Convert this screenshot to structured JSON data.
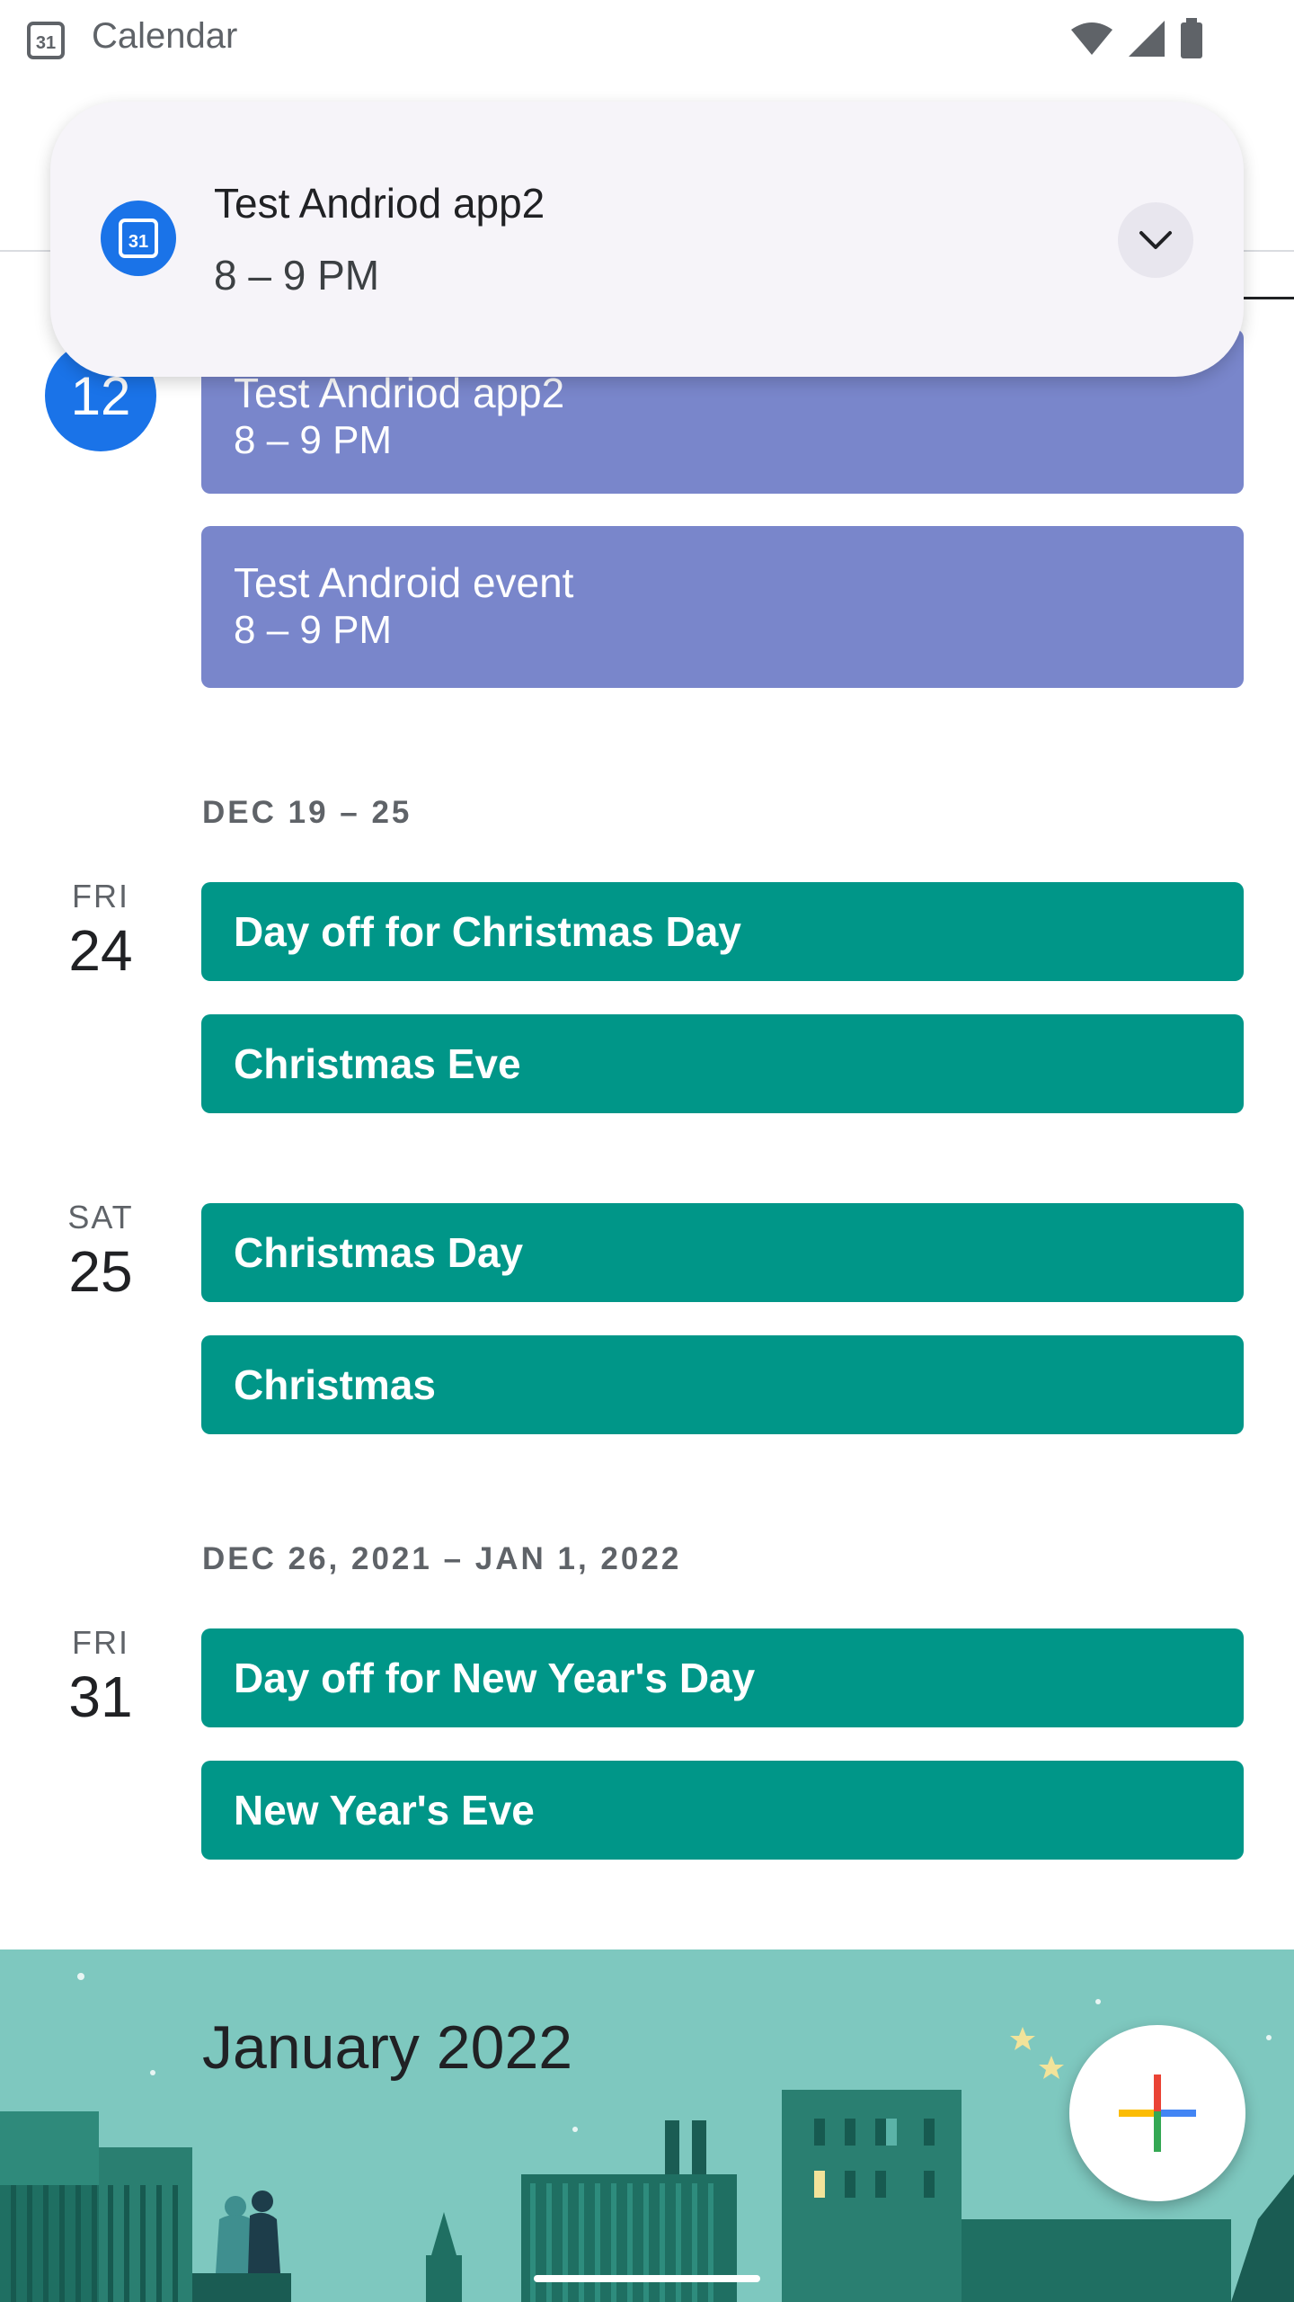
{
  "status_bar": {
    "app_name": "Calendar",
    "app_icon_text": "31"
  },
  "notification": {
    "icon_text": "31",
    "title": "Test Andriod app2",
    "time": "8 – 9 PM"
  },
  "today": {
    "day_number": "12",
    "events": [
      {
        "title": "Test Andriod app2",
        "time": "8 – 9 PM",
        "color": "#7986cb"
      },
      {
        "title": "Test Android event",
        "time": "8 – 9 PM",
        "color": "#7986cb"
      }
    ]
  },
  "weeks": [
    {
      "header": "DEC 19 – 25",
      "days": [
        {
          "dow": "FRI",
          "num": "24",
          "events": [
            "Day off for Christmas Day",
            "Christmas Eve"
          ]
        },
        {
          "dow": "SAT",
          "num": "25",
          "events": [
            "Christmas Day",
            "Christmas"
          ]
        }
      ]
    },
    {
      "header": "DEC 26, 2021 – JAN 1, 2022",
      "days": [
        {
          "dow": "FRI",
          "num": "31",
          "events": [
            "Day off for New Year's Day",
            "New Year's Eve"
          ]
        }
      ]
    }
  ],
  "month_banner": {
    "title": "January 2022"
  },
  "fab": {
    "icon": "plus-icon"
  },
  "colors": {
    "holiday": "#009688",
    "personal": "#7986cb",
    "accent": "#1a73e8"
  }
}
